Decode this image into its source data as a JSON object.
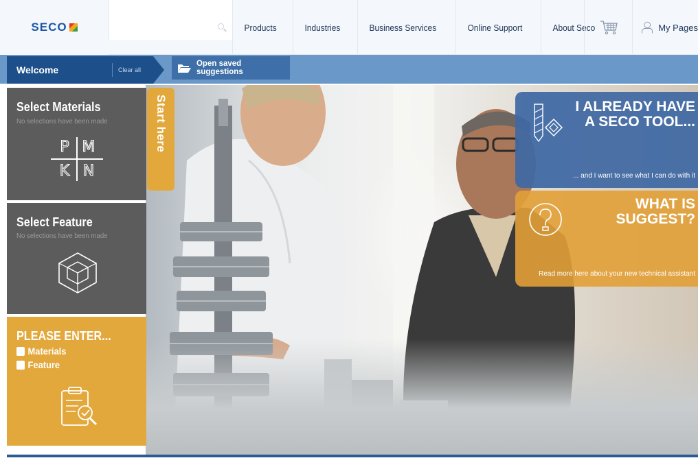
{
  "header": {
    "logo_text": "SECO",
    "nav": [
      "Products",
      "Industries",
      "Business Services",
      "Online Support",
      "About Seco"
    ],
    "my_pages": "My Pages"
  },
  "toolbar": {
    "welcome": "Welcome",
    "clear_all": "Clear all",
    "open_saved": "Open saved suggestions"
  },
  "start_here": "Start here",
  "panels": {
    "materials": {
      "title": "Select Materials",
      "subtitle": "No selections have been made",
      "letters": [
        "P",
        "M",
        "K",
        "N"
      ]
    },
    "feature": {
      "title": "Select Feature",
      "subtitle": "No selections have been made"
    },
    "please": {
      "title": "PLEASE ENTER...",
      "items": [
        "Materials",
        "Feature"
      ]
    }
  },
  "tiles": {
    "tool": {
      "line1": "I ALREADY HAVE",
      "line2": "A SECO TOOL...",
      "foot": "... and I want to see what I can do with it"
    },
    "suggest": {
      "line1": "WHAT IS",
      "line2": "SUGGEST?",
      "foot": "Read more here about your new technical assistant"
    }
  },
  "colors": {
    "brand_blue": "#1d4f8a",
    "toolbar_blue": "#6a98c9",
    "accent_orange": "#e3a83c",
    "panel_gray": "#5c5c5c"
  },
  "icons": [
    "search-icon",
    "cart-icon",
    "user-icon",
    "folder-open-icon",
    "pmkn-material-icon",
    "cube-feature-icon",
    "clipboard-check-icon",
    "tool-insert-icon",
    "question-icon"
  ]
}
